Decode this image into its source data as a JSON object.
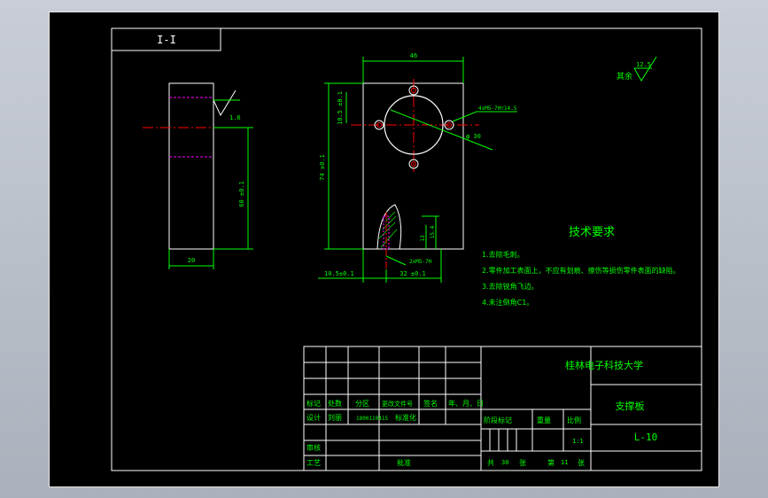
{
  "colors": {
    "background": "#000000",
    "outline": "#ffffff",
    "dimension": "#00ff00",
    "centerline": "#ff0000",
    "hidden": "#ff00ff",
    "annotation": "#00ff00"
  },
  "section_label": "I-I",
  "dims": {
    "width_top": "46",
    "height_left": "74 ±0.1",
    "hole_offset": "10.5 ±0.1",
    "hole_note": "4xM5-7H▽14.5",
    "circle_dia": "φ 30",
    "bottom_left": "10.5±0.1",
    "bottom_mid": "32 ±0.1",
    "bottom_thread": "2xM5-7H",
    "small_1": "13",
    "small_2": "15.4",
    "section_thick": "20",
    "section_height": "60 ±0.1",
    "section_arrow": "1.6"
  },
  "roughness": {
    "label": "其余",
    "value": "12.5"
  },
  "tech": {
    "title": "技术要求",
    "items": [
      "1.去除毛刺。",
      "2.零件加工表面上，不应有划痕、擦伤等损伤零件表面的缺陷。",
      "3.去除锐角飞边。",
      "4.未注倒角C1。"
    ]
  },
  "title_block": {
    "school": "桂林电子科技大学",
    "part_name": "支撑板",
    "drawing_no": "L-10",
    "headers": [
      "标记",
      "处数",
      "分区",
      "更改文件号",
      "签名",
      "年、月、日"
    ],
    "designer_label": "设计",
    "designer_name": "刘丽",
    "student_no": "1800110415",
    "std_label": "标准化",
    "stage_label": "阶段标记",
    "weight_label": "重量",
    "scale_label": "比例",
    "scale_value": "1:1",
    "review_label": "审核",
    "process_label": "工艺",
    "approve_label": "批准",
    "total_label": "共",
    "total_value": "30",
    "sheet_label": "张",
    "page_label": "第",
    "page_value": "11",
    "page_unit": "张"
  }
}
